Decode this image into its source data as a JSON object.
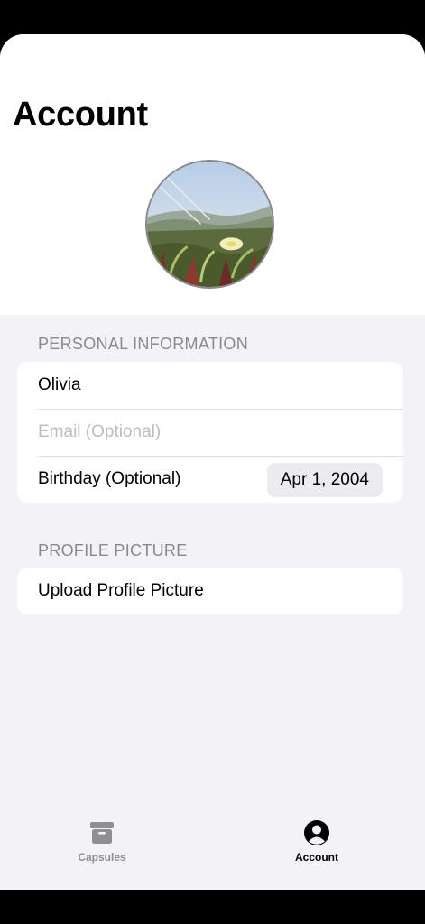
{
  "header": {
    "title": "Account"
  },
  "sections": {
    "personal": {
      "label": "PERSONAL INFORMATION",
      "name_value": "Olivia",
      "email_placeholder": "Email (Optional)",
      "birthday_label": "Birthday (Optional)",
      "birthday_value": "Apr 1, 2004"
    },
    "picture": {
      "label": "PROFILE PICTURE",
      "upload_label": "Upload Profile Picture"
    }
  },
  "tabs": [
    {
      "label": "Capsules",
      "icon": "archivebox-icon",
      "active": false
    },
    {
      "label": "Account",
      "icon": "person-circle-icon",
      "active": true
    }
  ],
  "colors": {
    "background": "#f2f2f7",
    "card": "#ffffff",
    "secondary_text": "#8a8a8e",
    "placeholder_text": "#bcbcc1",
    "tab_active": "#000000",
    "tab_inactive": "#8e8e93"
  }
}
